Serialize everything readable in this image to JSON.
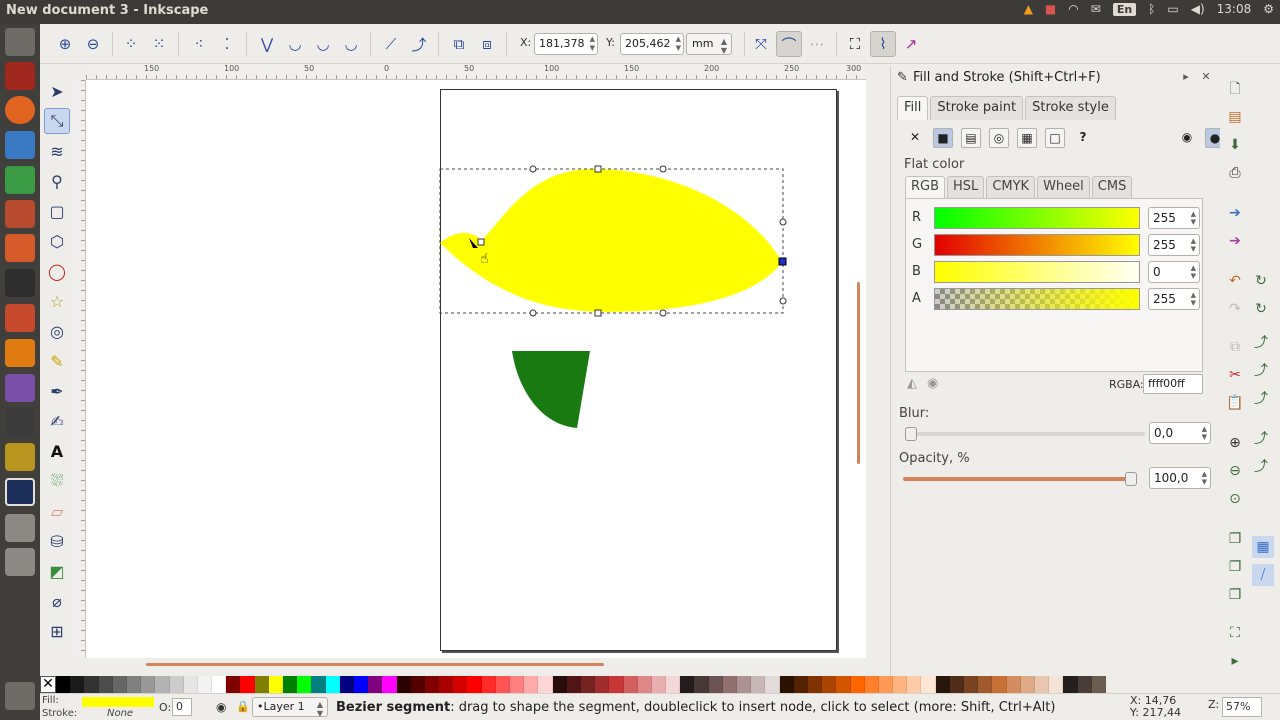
{
  "window": {
    "title": "New document 3 - Inkscape"
  },
  "tray": {
    "lang": "En",
    "time": "13:08"
  },
  "toolbar": {
    "x_label": "X:",
    "x_value": "181,378",
    "y_label": "Y:",
    "y_value": "205,462",
    "unit": "mm"
  },
  "ruler": {
    "ticks": [
      "150",
      "100",
      "50",
      "0",
      "50",
      "100",
      "150",
      "200",
      "250",
      "300"
    ]
  },
  "dock": {
    "title": "Fill and Stroke (Shift+Ctrl+F)",
    "tabs": [
      "Fill",
      "Stroke paint",
      "Stroke style"
    ],
    "flat_color": "Flat color",
    "modes": [
      "RGB",
      "HSL",
      "CMYK",
      "Wheel",
      "CMS"
    ],
    "channels": [
      {
        "label": "R",
        "value": "255"
      },
      {
        "label": "G",
        "value": "255"
      },
      {
        "label": "B",
        "value": "0"
      },
      {
        "label": "A",
        "value": "255"
      }
    ],
    "rgba_label": "RGBA:",
    "rgba_value": "ffff00ff",
    "blur_label": "Blur:",
    "blur_value": "0,0",
    "blur_level": 0.0,
    "opacity_label": "Opacity, %",
    "opacity_value": "100,0",
    "opacity_level": 1.0
  },
  "status": {
    "fill_label": "Fill:",
    "stroke_label": "Stroke:",
    "stroke_value": "None",
    "o_label": "O:",
    "o_value": "0",
    "layer": "•Layer 1",
    "message_bold": "Bezier segment",
    "message_rest": ": drag to shape the segment, doubleclick to insert node, click to select (more: Shift, Ctrl+Alt)",
    "x_label": "X:",
    "x_value": "14,76",
    "y_label": "Y:",
    "y_value": "217,44",
    "z_label": "Z:",
    "zoom": "57%"
  },
  "colors": {
    "fill": "#ffff00",
    "green": "#1a7a12",
    "accent": "#d4845a"
  },
  "palette": [
    "#000000",
    "#1a1a1a",
    "#333333",
    "#4d4d4d",
    "#666666",
    "#808080",
    "#999999",
    "#b3b3b3",
    "#cccccc",
    "#e6e6e6",
    "#f2f2f2",
    "#ffffff",
    "#800000",
    "#ff0000",
    "#808000",
    "#ffff00",
    "#008000",
    "#00ff00",
    "#008080",
    "#00ffff",
    "#000080",
    "#0000ff",
    "#800080",
    "#ff00ff",
    "#2b0000",
    "#550000",
    "#800000",
    "#aa0000",
    "#d40000",
    "#ff0000",
    "#ff2a2a",
    "#ff5555",
    "#ff8080",
    "#ffaaaa",
    "#ffd5d5",
    "#280b0b",
    "#501616",
    "#782121",
    "#a02c2c",
    "#c83737",
    "#d35f5f",
    "#de8787",
    "#e9afaf",
    "#f4d7d7",
    "#241c1c",
    "#483737",
    "#6c5353",
    "#916f6f",
    "#ac9393",
    "#c8b7b7",
    "#e3dbdb",
    "#2b1100",
    "#552200",
    "#803300",
    "#aa4400",
    "#d45500",
    "#ff6600",
    "#ff7f2a",
    "#ff9955",
    "#ffb380",
    "#ffccaa",
    "#ffe6d5",
    "#28170b",
    "#502d16",
    "#784421",
    "#a05a2c",
    "#c87137",
    "#d38d5f",
    "#deaa87",
    "#e9c6af",
    "#f4e3d7",
    "#241f1c",
    "#483e37",
    "#6c5d53"
  ]
}
